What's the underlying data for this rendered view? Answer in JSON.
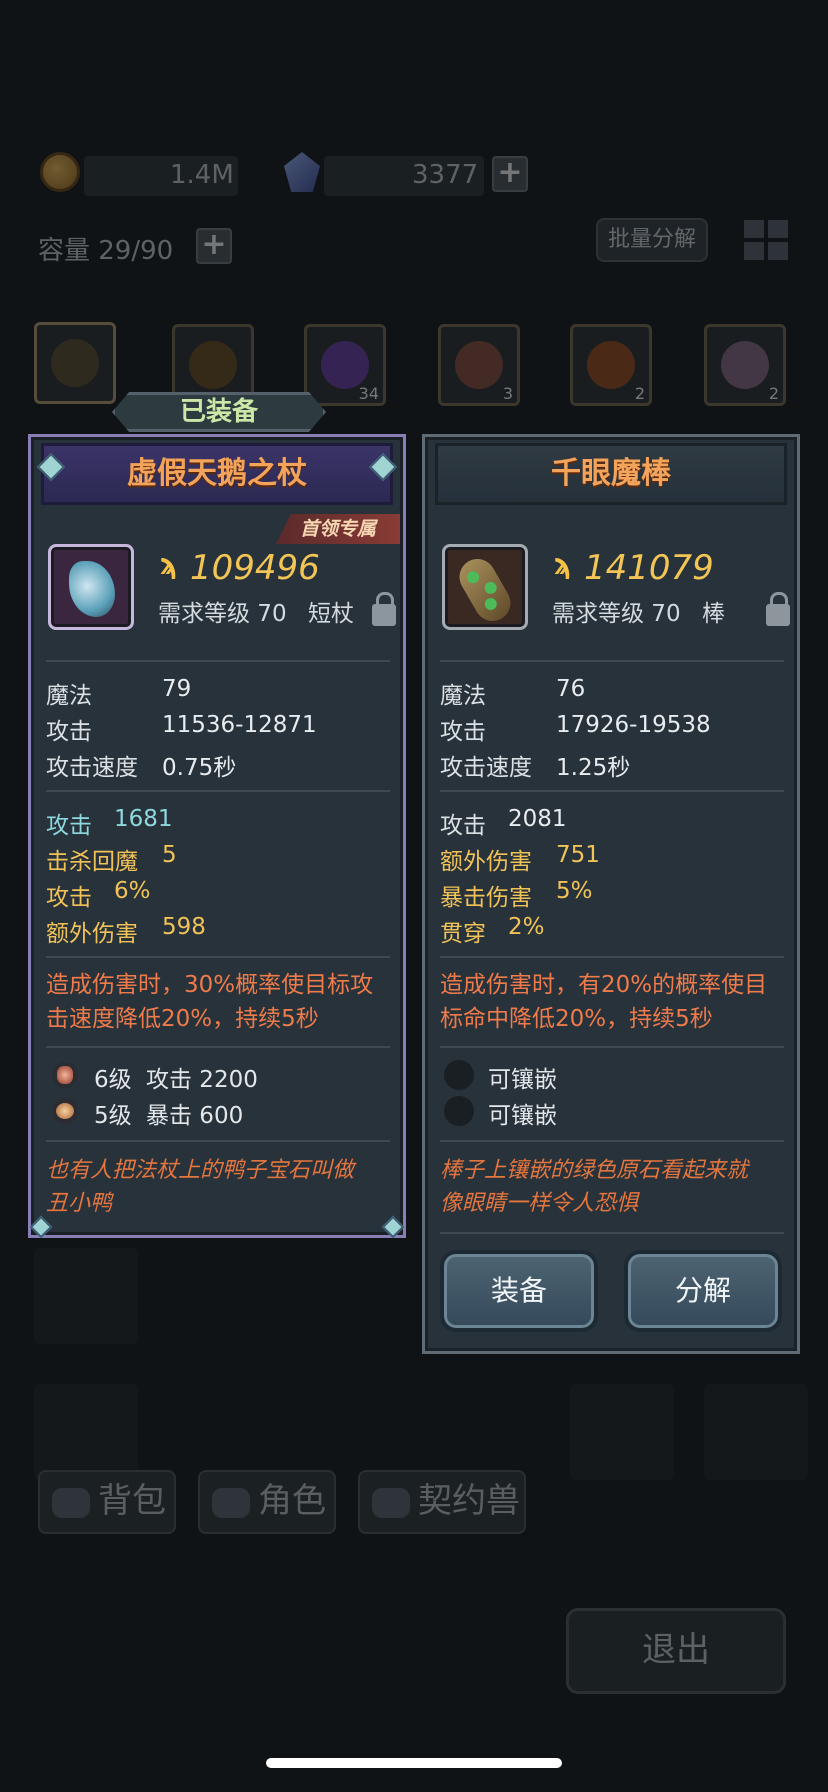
{
  "header": {
    "gold": "1.4M",
    "gems": "3377",
    "capacity": "容量 29/90",
    "batch_decompose": "批量分解"
  },
  "inventory_slots": [
    {
      "count": "",
      "icon": "club-icon"
    },
    {
      "count": "",
      "icon": "helmet-icon"
    },
    {
      "count": "34",
      "icon": "purple-orb-icon"
    },
    {
      "count": "3",
      "icon": "meat-icon"
    },
    {
      "count": "2",
      "icon": "fire-icon"
    },
    {
      "count": "2",
      "icon": "egg-icon"
    }
  ],
  "bottom_tabs": {
    "bag": "背包",
    "role": "角色",
    "pet": "契约兽"
  },
  "exit_label": "退出",
  "equipped": {
    "tag": "已装备",
    "name": "虚假天鹅之杖",
    "badge": "首领专属",
    "power": "109496",
    "req_level": "需求等级 70",
    "item_type": "短杖",
    "base_stats": [
      {
        "k": "魔法",
        "v": "79"
      },
      {
        "k": "攻击",
        "v": "11536-12871"
      },
      {
        "k": "攻击速度",
        "v": "0.75秒"
      }
    ],
    "extra_stats": [
      {
        "k": "攻击",
        "v": "1681"
      },
      {
        "k": "击杀回魔",
        "v": "5"
      },
      {
        "k": "攻击",
        "v": "6%"
      },
      {
        "k": "额外伤害",
        "v": "598"
      }
    ],
    "effect_line1": "造成伤害时，30%概率使目标攻",
    "effect_line2": "击速度降低20%，持续5秒",
    "gems": [
      {
        "level": "6级",
        "stat": "攻击 2200"
      },
      {
        "level": "5级",
        "stat": "暴击 600"
      }
    ],
    "flavor_line1": "也有人把法杖上的鸭子宝石叫做",
    "flavor_line2": "丑小鸭"
  },
  "candidate": {
    "name": "千眼魔棒",
    "power": "141079",
    "req_level": "需求等级 70",
    "item_type": "棒",
    "base_stats": [
      {
        "k": "魔法",
        "v": "76"
      },
      {
        "k": "攻击",
        "v": "17926-19538"
      },
      {
        "k": "攻击速度",
        "v": "1.25秒"
      }
    ],
    "extra_stats": [
      {
        "k": "攻击",
        "v": "2081"
      },
      {
        "k": "额外伤害",
        "v": "751"
      },
      {
        "k": "暴击伤害",
        "v": "5%"
      },
      {
        "k": "贯穿",
        "v": "2%"
      }
    ],
    "effect_line1": "造成伤害时，有20%的概率使目",
    "effect_line2": "标命中降低20%，持续5秒",
    "sockets": [
      "可镶嵌",
      "可镶嵌"
    ],
    "flavor_line1": "棒子上镶嵌的绿色原石看起来就",
    "flavor_line2": "像眼睛一样令人恐惧",
    "equip_button": "装备",
    "decompose_button": "分解"
  }
}
